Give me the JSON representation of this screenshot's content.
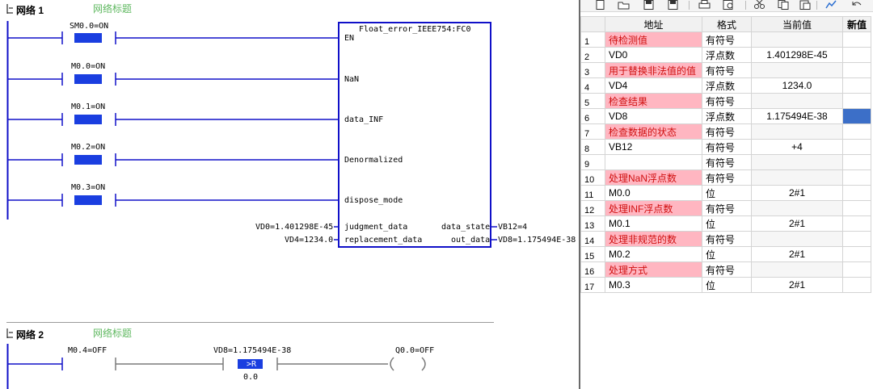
{
  "ladder": {
    "network1": {
      "collapse_icon": "minus-box-icon",
      "label": "网络 1",
      "title": "网络标题",
      "contacts": [
        "SM0.0=ON",
        "M0.0=ON",
        "M0.1=ON",
        "M0.2=ON",
        "M0.3=ON"
      ],
      "block": {
        "name": "Float_error_IEEE754:FC0",
        "inputs": [
          "EN",
          "NaN",
          "data_INF",
          "Denormalized",
          "dispose_mode",
          "judgment_data",
          "replacement_data"
        ],
        "outputs": [
          "data_state",
          "out_data"
        ],
        "input_values": [
          "VD0=1.401298E-45",
          "VD4=1234.0"
        ],
        "output_values": [
          "VB12=4",
          "VD8=1.175494E-38"
        ]
      }
    },
    "network2": {
      "collapse_icon": "minus-box-icon",
      "label": "网络 2",
      "title": "网络标题",
      "contact": "M0.4=OFF",
      "compare_top": "VD8=1.175494E-38",
      "compare_op": ">R",
      "compare_bottom": "0.0",
      "coil": "Q0.0=OFF"
    }
  },
  "status_chart": {
    "toolbar_icons": [
      "new-icon",
      "open-icon",
      "save-icon",
      "save-all-icon",
      "print-icon",
      "print-preview-icon",
      "cut-icon",
      "copy-icon",
      "paste-icon",
      "trend-icon",
      "undo-icon"
    ],
    "headers": {
      "addr": "地址",
      "fmt": "格式",
      "cur": "当前值",
      "new": "新值"
    },
    "rows": [
      {
        "n": "1",
        "addr": "待检测值",
        "fmt": "有符号",
        "cur": "",
        "lbl": true
      },
      {
        "n": "2",
        "addr": "VD0",
        "fmt": "浮点数",
        "cur": "1.401298E-45",
        "lbl": false
      },
      {
        "n": "3",
        "addr": "用于替换非法值的值",
        "fmt": "有符号",
        "cur": "",
        "lbl": true
      },
      {
        "n": "4",
        "addr": "VD4",
        "fmt": "浮点数",
        "cur": "1234.0",
        "lbl": false
      },
      {
        "n": "5",
        "addr": "检查结果",
        "fmt": "有符号",
        "cur": "",
        "lbl": true
      },
      {
        "n": "6",
        "addr": "VD8",
        "fmt": "浮点数",
        "cur": "1.175494E-38",
        "lbl": false,
        "sel": true
      },
      {
        "n": "7",
        "addr": "检查数据的状态",
        "fmt": "有符号",
        "cur": "",
        "lbl": true
      },
      {
        "n": "8",
        "addr": "VB12",
        "fmt": "有符号",
        "cur": "+4",
        "lbl": false
      },
      {
        "n": "9",
        "addr": "",
        "fmt": "有符号",
        "cur": "",
        "lbl": false
      },
      {
        "n": "10",
        "addr": "处理NaN浮点数",
        "fmt": "有符号",
        "cur": "",
        "lbl": true
      },
      {
        "n": "11",
        "addr": "M0.0",
        "fmt": "位",
        "cur": "2#1",
        "lbl": false
      },
      {
        "n": "12",
        "addr": "处理INF浮点数",
        "fmt": "有符号",
        "cur": "",
        "lbl": true
      },
      {
        "n": "13",
        "addr": "M0.1",
        "fmt": "位",
        "cur": "2#1",
        "lbl": false
      },
      {
        "n": "14",
        "addr": "处理非规范的数",
        "fmt": "有符号",
        "cur": "",
        "lbl": true
      },
      {
        "n": "15",
        "addr": "M0.2",
        "fmt": "位",
        "cur": "2#1",
        "lbl": false
      },
      {
        "n": "16",
        "addr": "处理方式",
        "fmt": "有符号",
        "cur": "",
        "lbl": true
      },
      {
        "n": "17",
        "addr": "M0.3",
        "fmt": "位",
        "cur": "2#1",
        "lbl": false
      }
    ]
  },
  "colors": {
    "wire": "#1010c8",
    "contact_on": "#1a3ee0",
    "label_bg": "#ffb6c1",
    "label_fg": "#d01010",
    "selected": "#3c6fc8",
    "title_green": "#5fb860"
  }
}
